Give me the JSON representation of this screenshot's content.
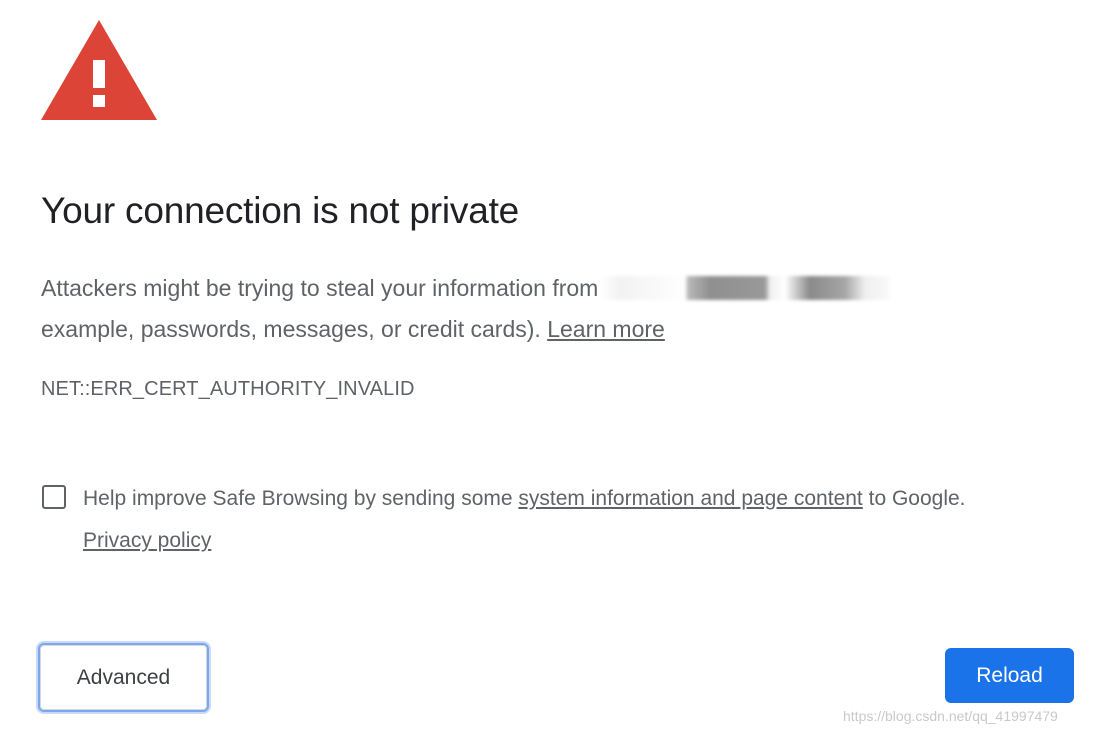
{
  "icon": {
    "name": "warning-triangle-icon",
    "color": "#db4437"
  },
  "title": "Your connection is not private",
  "description": {
    "text_before": "Attackers might be trying to steal your information from",
    "text_after": "example, passwords, messages, or credit cards).",
    "learn_more": "Learn more"
  },
  "error_code": "NET::ERR_CERT_AUTHORITY_INVALID",
  "safe_browsing": {
    "checked": false,
    "text_before": "Help improve Safe Browsing by sending some",
    "link": "system information and page content",
    "text_after": "to Google.",
    "privacy_link": "Privacy policy"
  },
  "buttons": {
    "advanced": "Advanced",
    "reload": "Reload",
    "reload_color": "#1a73e8"
  },
  "watermark": "https://blog.csdn.net/qq_41997479"
}
